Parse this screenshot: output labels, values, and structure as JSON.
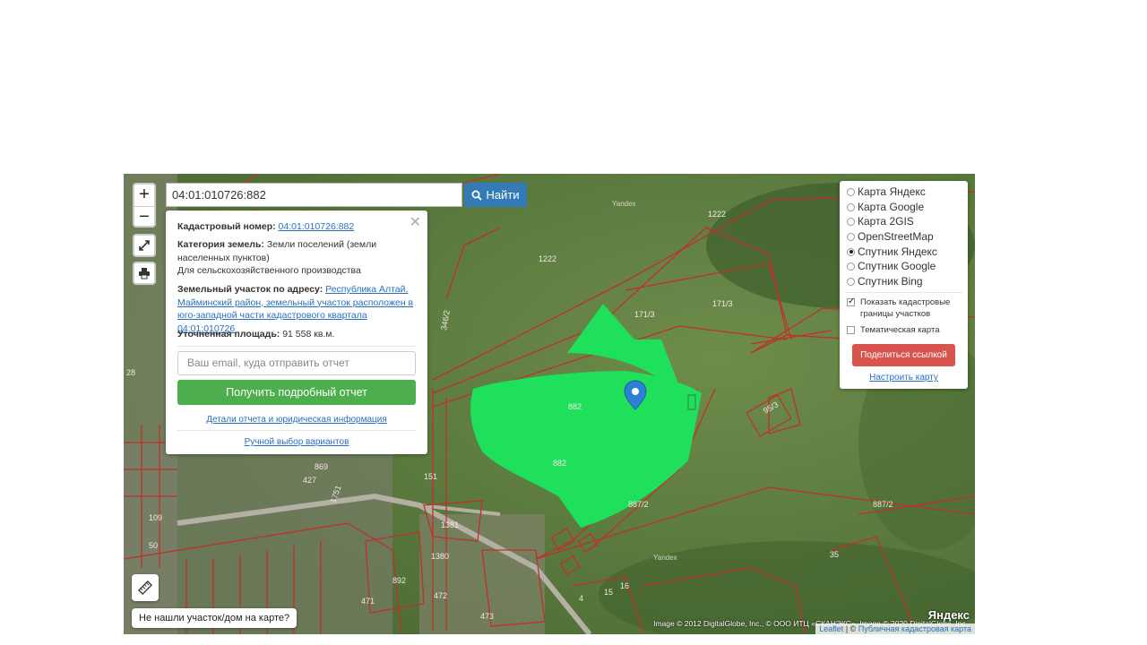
{
  "search": {
    "value": "04:01:010726:882",
    "button_label": "Найти"
  },
  "info": {
    "cadastral_number_label": "Кадастровый номер:",
    "cadastral_number": "04:01:010726:882",
    "category_label": "Категория земель:",
    "category_value": "Земли поселений (земли населенных пунктов)",
    "category_purpose": "Для сельскохозяйственного производства",
    "address_label": "Земельный участок по адресу:",
    "address_value": "Республика Алтай, Майминский район, земельный участок расположен в юго-западной части кадастрового квартала 04:01:010726",
    "area_label": "Уточненная площадь:",
    "area_value": "91 558 кв.м.",
    "email_placeholder": "Ваш email, куда отправить отчет",
    "report_button": "Получить подробный отчет",
    "details_link": "Детали отчета и юридическая информация",
    "manual_link": "Ручной выбор вариантов"
  },
  "layers": {
    "options": [
      {
        "label": "Карта Яндекс",
        "selected": false
      },
      {
        "label": "Карта Google",
        "selected": false
      },
      {
        "label": "Карта 2GIS",
        "selected": false
      },
      {
        "label": "OpenStreetMap",
        "selected": false
      },
      {
        "label": "Спутник Яндекс",
        "selected": true
      },
      {
        "label": "Спутник Google",
        "selected": false
      },
      {
        "label": "Спутник Bing",
        "selected": false
      }
    ],
    "show_borders_label": "Показать кадастровые границы участков",
    "show_borders_checked": true,
    "thematic_label": "Тематическая карта",
    "thematic_checked": false,
    "share_button": "Поделиться ссылкой",
    "setup_link": "Настроить карту"
  },
  "map": {
    "zoom_in": "+",
    "zoom_out": "−",
    "not_found_button": "Не нашли участок/дом на карте?",
    "imagery_attribution": "Image © 2012 DigitalGlobe, Inc., © ООО ИТЦ «СКАНЭКС», Image © 2020 DigitalGlobe, Inc.",
    "leaflet_link": "Leaflet",
    "source_link": "Публичная кадастровая карта",
    "yandex_logo": "Яндекс",
    "parcel_labels": {
      "p1222a": "1222",
      "p1222b": "1222",
      "p171_3a": "171/3",
      "p171_3b": "171/3",
      "p346_2": "346/2",
      "p882a": "882",
      "p882b": "882",
      "p95_3": "95/3",
      "p887_2a": "887/2",
      "p887_2b": "887/2",
      "p1381": "1381",
      "p151": "151",
      "p1380": "1380",
      "p892": "892",
      "p472": "472",
      "p473": "473",
      "p869": "869",
      "p427": "427",
      "p1751": "1751",
      "p28": "28",
      "p109": "109",
      "p50": "50",
      "p16": "16",
      "p35": "35",
      "p15": "15",
      "p4": "4",
      "p471": "471",
      "yandex_watermark_a": "Yandex",
      "yandex_watermark_b": "Yandex"
    },
    "colors": {
      "selected_parcel": "#1fe05a",
      "parcel_border": "#c0312b"
    }
  }
}
